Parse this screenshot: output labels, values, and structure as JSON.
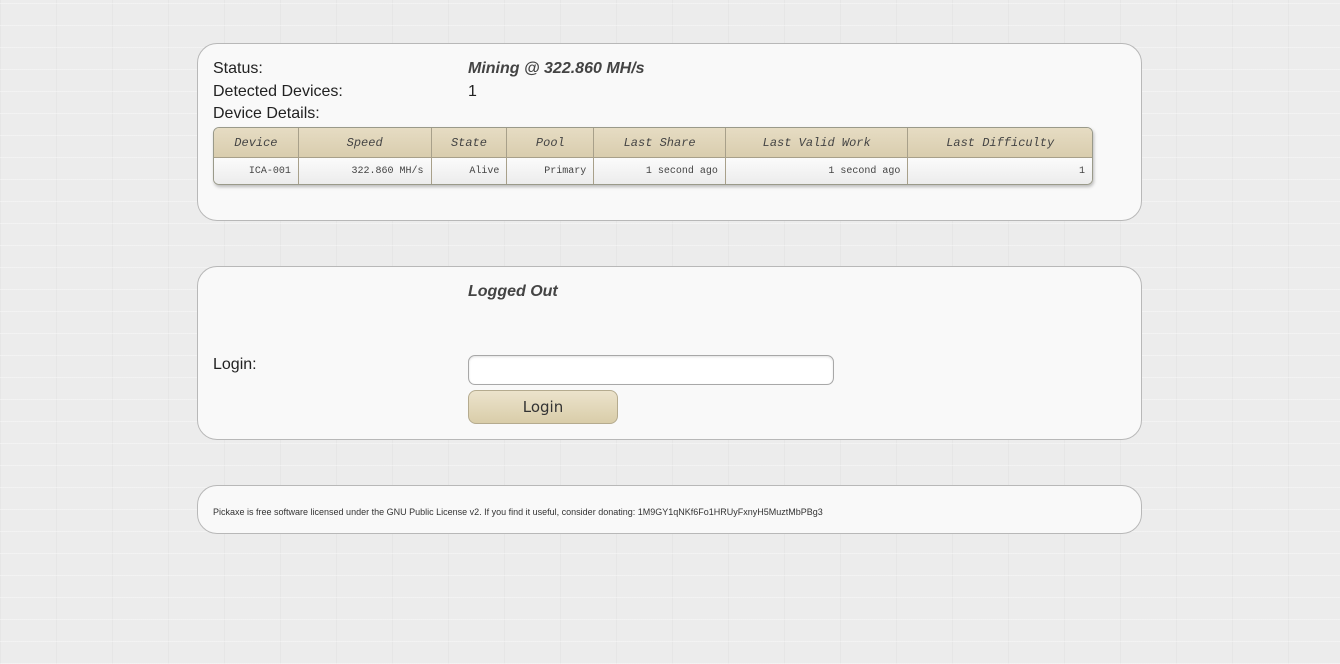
{
  "status_panel": {
    "status_label": "Status:",
    "status_value": "Mining @ 322.860 MH/s",
    "detected_label": "Detected Devices:",
    "detected_value": "1",
    "details_label": "Device Details:"
  },
  "device_table": {
    "headers": [
      "Device",
      "Speed",
      "State",
      "Pool",
      "Last Share",
      "Last Valid Work",
      "Last Difficulty"
    ],
    "rows": [
      [
        "ICA-001",
        "322.860 MH/s",
        "Alive",
        "Primary",
        "1 second ago",
        "1 second ago",
        "1"
      ]
    ]
  },
  "login_panel": {
    "state": "Logged Out",
    "login_label": "Login:",
    "input_value": "",
    "button_label": "Login"
  },
  "footer": {
    "text": "Pickaxe is free software licensed under the GNU Public License v2. If you find it useful, consider donating: 1M9GY1qNKf6Fo1HRUyFxnyH5MuztMbPBg3"
  },
  "colors": {
    "table_header": "#ddd2b6",
    "button": "#e2d8bb",
    "panel": "#f9f9f9",
    "background": "#ececec"
  }
}
